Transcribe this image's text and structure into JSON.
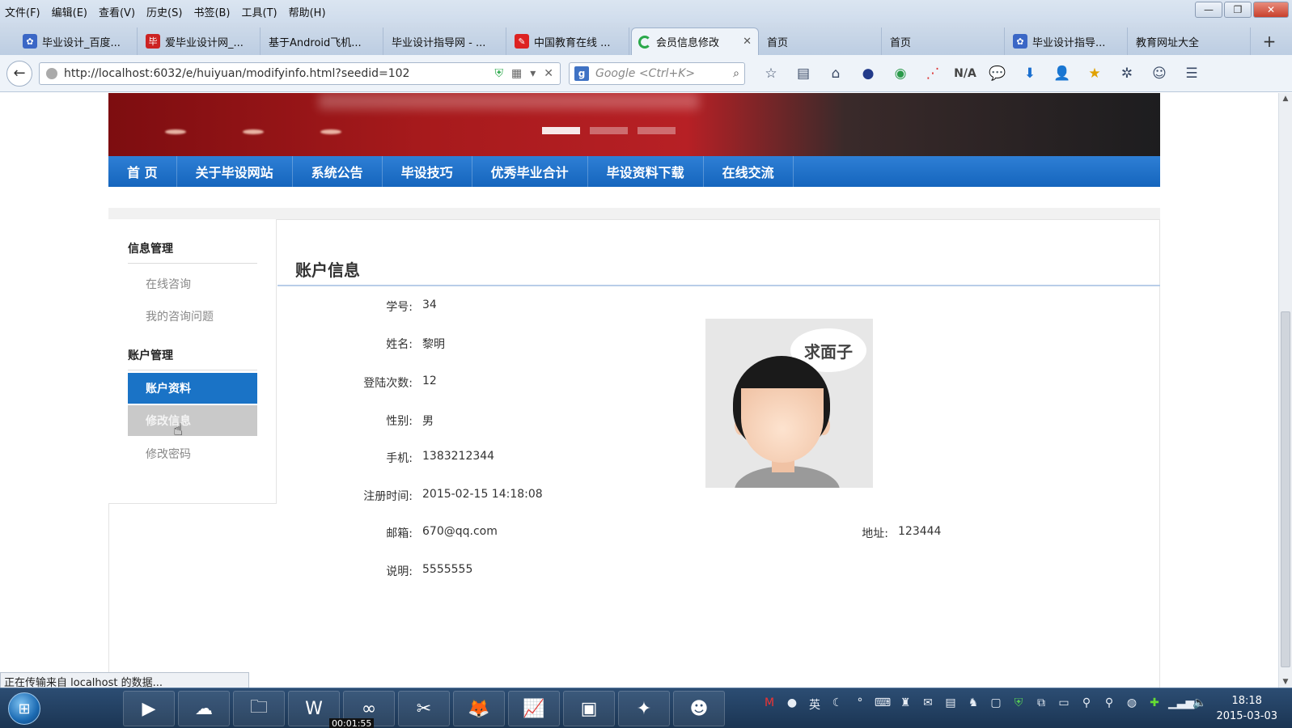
{
  "menu": [
    "文件(F)",
    "编辑(E)",
    "查看(V)",
    "历史(S)",
    "书签(B)",
    "工具(T)",
    "帮助(H)"
  ],
  "window_controls": {
    "minimize": "—",
    "restore": "❐",
    "close": "✕"
  },
  "tabs": [
    {
      "title": "毕业设计_百度...",
      "icon": "baidu-paw-icon",
      "color": "#3b67c6"
    },
    {
      "title": "爱毕业设计网_...",
      "icon": "site-logo-icon",
      "color": "#cc2222"
    },
    {
      "title": "基于Android飞机...",
      "icon": "",
      "color": ""
    },
    {
      "title": "毕业设计指导网 - ...",
      "icon": "",
      "color": ""
    },
    {
      "title": "中国教育在线 ...",
      "icon": "edu-online-icon",
      "color": "#d22"
    },
    {
      "title": "会员信息修改",
      "icon": "loading-spinner-icon",
      "color": "#2aa84a",
      "active": true
    },
    {
      "title": "首页",
      "icon": "",
      "color": ""
    },
    {
      "title": "首页",
      "icon": "",
      "color": ""
    },
    {
      "title": "毕业设计指导...",
      "icon": "baidu-paw-icon",
      "color": "#3b67c6"
    },
    {
      "title": "教育网址大全",
      "icon": "",
      "color": ""
    }
  ],
  "address": {
    "url": "http://localhost:6032/e/huiyuan/modifyinfo.html?seedid=102",
    "search_placeholder": "Google <Ctrl+K>",
    "na_label": "N/A"
  },
  "site_nav": [
    "首 页",
    "关于毕设网站",
    "系统公告",
    "毕设技巧",
    "优秀毕业合计",
    "毕设资料下载",
    "在线交流"
  ],
  "sidebar": {
    "section1_title": "信息管理",
    "section1_items": [
      "在线咨询",
      "我的咨询问题"
    ],
    "section2_title": "账户管理",
    "section2_items": [
      {
        "label": "账户资料",
        "state": "active"
      },
      {
        "label": "修改信息",
        "state": "hover"
      },
      {
        "label": "修改密码",
        "state": "normal"
      }
    ]
  },
  "account": {
    "title": "账户信息",
    "fields": [
      {
        "label": "学号:",
        "value": "34"
      },
      {
        "label": "姓名:",
        "value": "黎明"
      },
      {
        "label": "登陆次数:",
        "value": "12"
      },
      {
        "label": "性别:",
        "value": "男"
      },
      {
        "label": "手机:",
        "value": "1383212344"
      },
      {
        "label": "注册时间:",
        "value": "2015-02-15 14:18:08"
      },
      {
        "label": "邮箱:",
        "value": "670@qq.com"
      },
      {
        "label": "说明:",
        "value": "5555555"
      }
    ],
    "address_label": "地址:",
    "address_value": "123444",
    "avatar_bubble": "求面子"
  },
  "status_text": "正在传输来自 localhost 的数据...",
  "taskbar": {
    "time": "18:18",
    "date": "2015-03-03",
    "timer": "00:01:55"
  },
  "colors": {
    "nav_blue": "#1a6fc8",
    "sidebar_active": "#1a73c6",
    "banner_red": "#a71a1c"
  }
}
